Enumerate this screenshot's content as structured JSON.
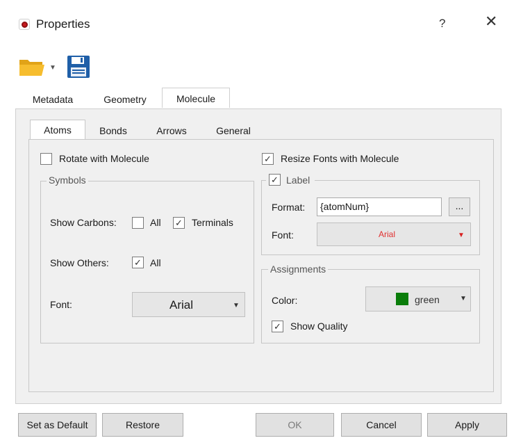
{
  "window": {
    "title": "Properties",
    "help": "?",
    "close": "✕"
  },
  "toolbar": {
    "open_icon": "folder-icon",
    "save_icon": "floppy-disk-icon"
  },
  "tabs": [
    {
      "label": "Metadata",
      "active": false
    },
    {
      "label": "Geometry",
      "active": false
    },
    {
      "label": "Molecule",
      "active": true
    }
  ],
  "subtabs": [
    {
      "label": "Atoms",
      "active": true
    },
    {
      "label": "Bonds",
      "active": false
    },
    {
      "label": "Arrows",
      "active": false
    },
    {
      "label": "General",
      "active": false
    }
  ],
  "atoms": {
    "rotate_with_molecule": {
      "label": "Rotate with Molecule",
      "checked": false
    },
    "resize_fonts": {
      "label": "Resize Fonts with Molecule",
      "checked": true
    },
    "symbols": {
      "title": "Symbols",
      "show_carbons_label": "Show Carbons:",
      "carbons_all": {
        "label": "All",
        "checked": false
      },
      "carbons_terminals": {
        "label": "Terminals",
        "checked": true
      },
      "show_others_label": "Show Others:",
      "others_all": {
        "label": "All",
        "checked": true
      },
      "font_label": "Font:",
      "font_value": "Arial"
    },
    "label_group": {
      "title": "Label",
      "checked": true,
      "format_label": "Format:",
      "format_value": "{atomNum}",
      "browse_button": "...",
      "font_label": "Font:",
      "font_value": "Arial",
      "font_color": "#e03030"
    },
    "assignments": {
      "title": "Assignments",
      "color_label": "Color:",
      "color_value": "green",
      "color_swatch": "#0a7d0a",
      "show_quality": {
        "label": "Show Quality",
        "checked": true
      }
    }
  },
  "buttons": {
    "set_default": "Set as Default",
    "restore": "Restore",
    "ok": "OK",
    "cancel": "Cancel",
    "apply": "Apply"
  },
  "check_glyph": "✓"
}
